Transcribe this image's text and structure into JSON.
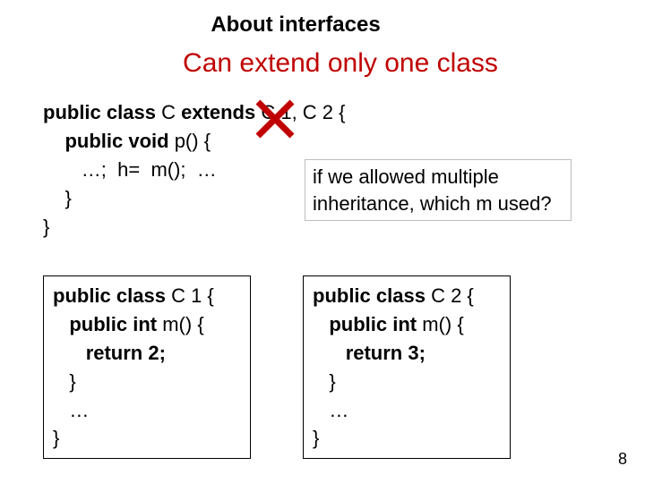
{
  "header": {
    "title": "About interfaces"
  },
  "subtitle": "Can extend only one class",
  "codeC": {
    "line1a": "public class",
    "line1b": " C ",
    "line1c": "extends",
    "line1d": " C 1, C 2 {",
    "line2a": "public void",
    "line2b": " p() {",
    "line3": "…;  h=  m();  …",
    "line4": "}",
    "line5": "}"
  },
  "callout": "if we allowed multiple inheritance, which m used?",
  "c1": {
    "l1a": "public class",
    "l1b": " C 1 {",
    "l2a": "public int",
    "l2b": " m() {",
    "l3": "return 2;",
    "l4": "}",
    "l5": "…",
    "l6": "}"
  },
  "c2": {
    "l1a": "public class",
    "l1b": " C 2 {",
    "l2a": "public int",
    "l2b": " m() {",
    "l3": "return 3;",
    "l4": "}",
    "l5": "…",
    "l6": "}"
  },
  "pagenum": "8"
}
